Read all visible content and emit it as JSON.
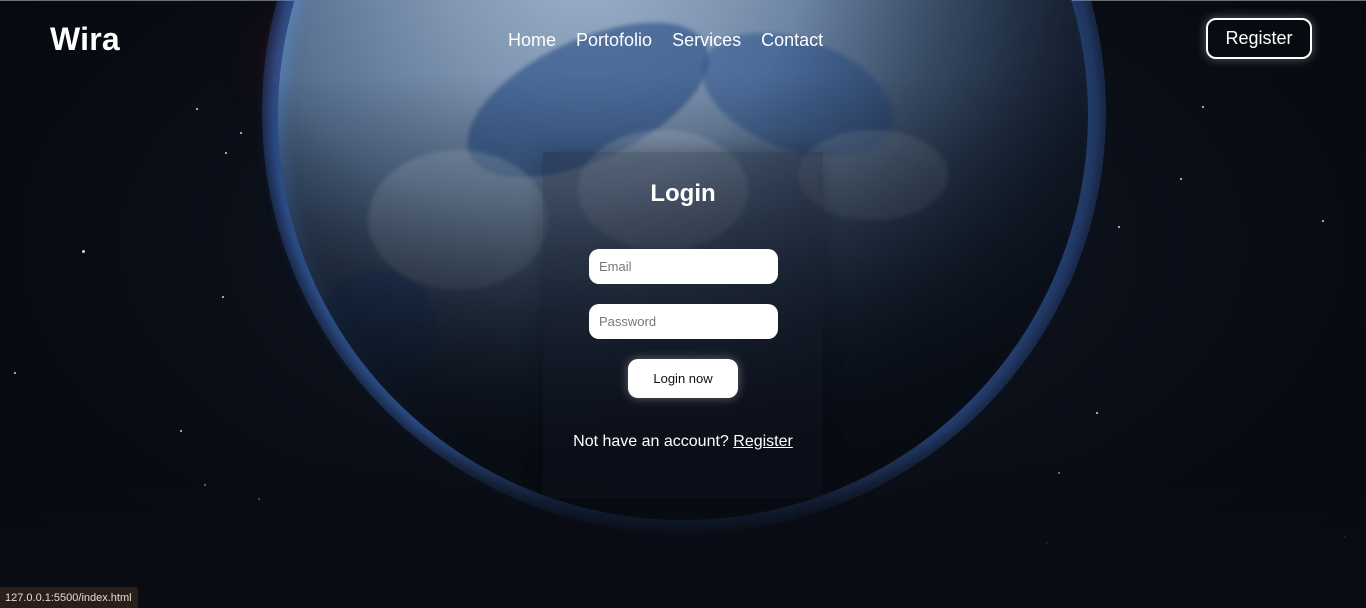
{
  "brand": {
    "logo": "Wira"
  },
  "nav": {
    "items": [
      {
        "label": "Home"
      },
      {
        "label": "Portofolio"
      },
      {
        "label": "Services"
      },
      {
        "label": "Contact"
      }
    ],
    "register_label": "Register"
  },
  "login": {
    "title": "Login",
    "email_placeholder": "Email",
    "password_placeholder": "Password",
    "submit_label": "Login now",
    "signup_prompt": "Not have an account?",
    "signup_link": "Register"
  },
  "statusbar": {
    "url": "127.0.0.1:5500/index.html"
  },
  "colors": {
    "background": "#0a0e17",
    "text": "#ffffff",
    "button_bg": "#ffffff",
    "planet_rim": "#4a8cff"
  }
}
